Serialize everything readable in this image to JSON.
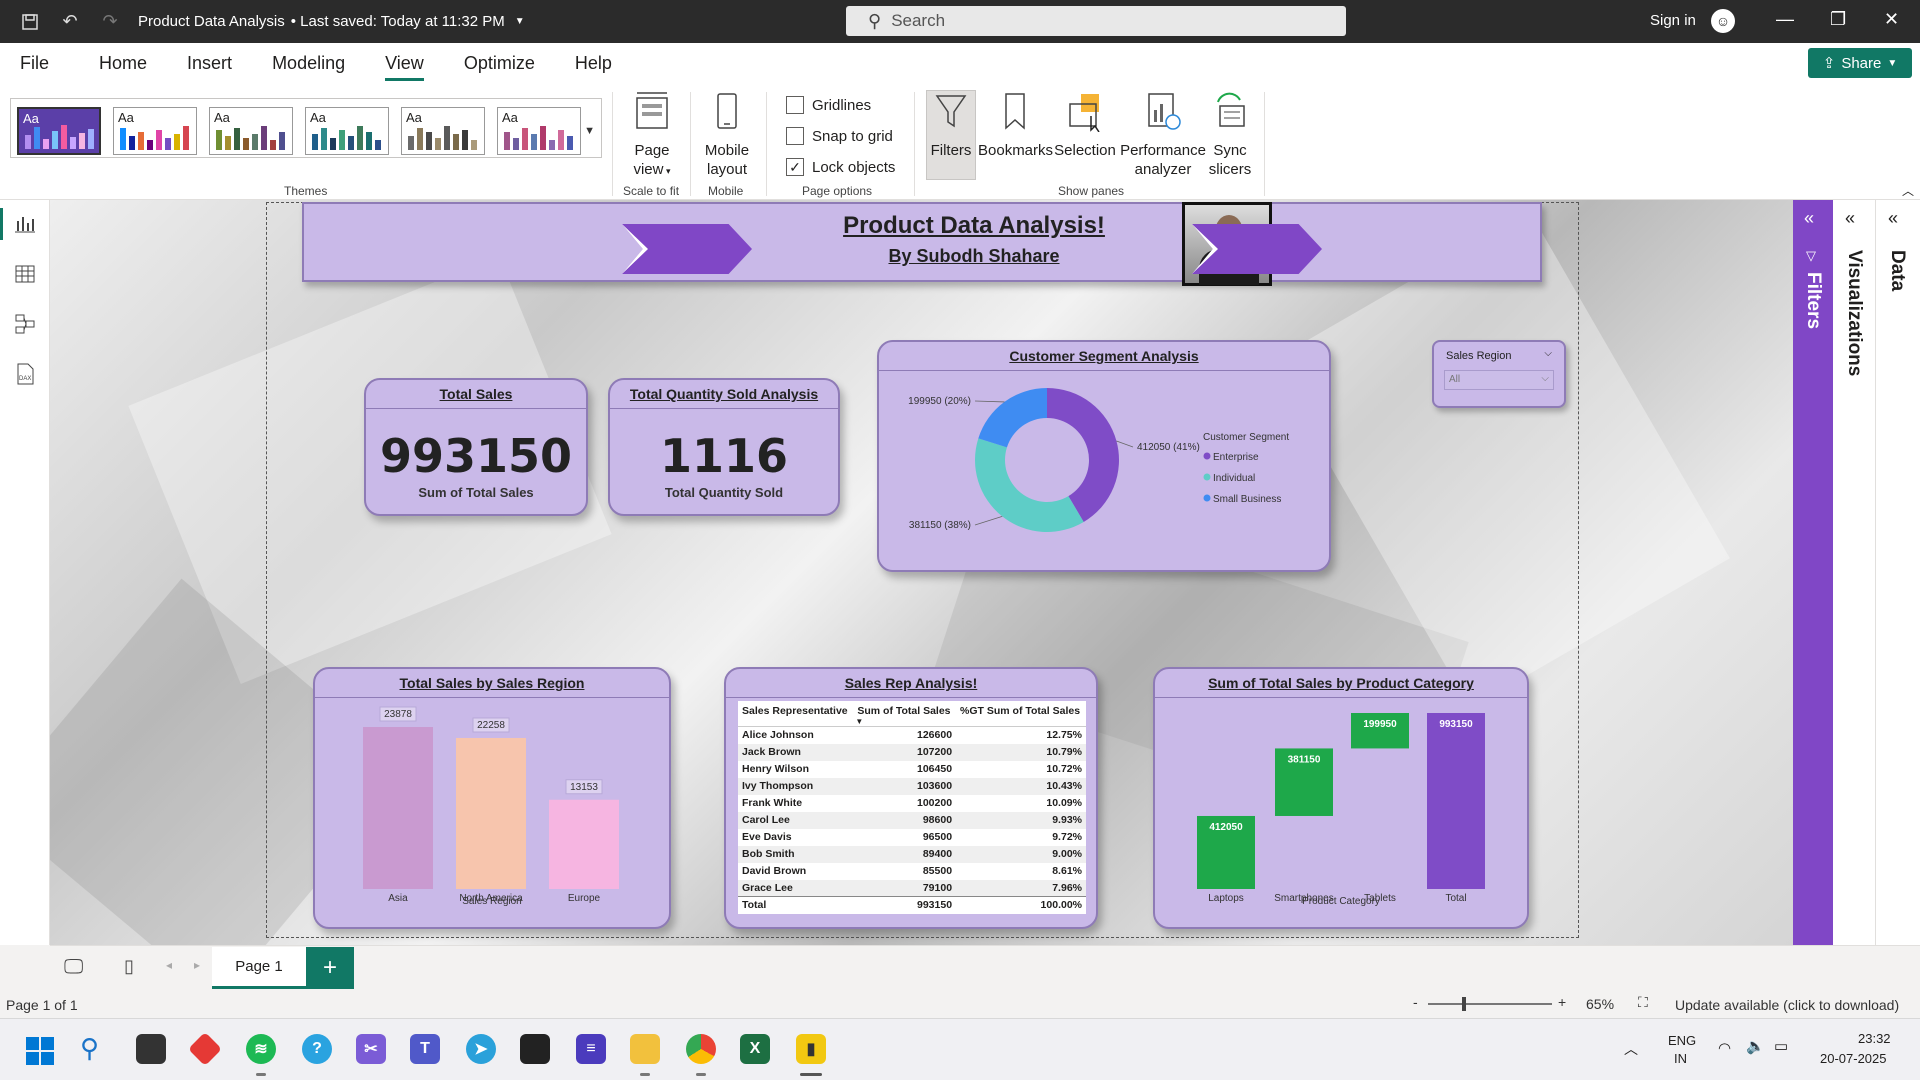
{
  "app": {
    "title": "Product Data Analysis",
    "saved": "• Last saved: Today at 11:32 PM",
    "search_placeholder": "Search",
    "sign_in": "Sign in",
    "share": "Share"
  },
  "menu": [
    "File",
    "Home",
    "Insert",
    "Modeling",
    "View",
    "Optimize",
    "Help"
  ],
  "menu_active": "View",
  "ribbon": {
    "themes_label": "Themes",
    "page_view": [
      "Page",
      "view"
    ],
    "scale_to_fit": "Scale to fit",
    "mobile_layout": [
      "Mobile",
      "layout"
    ],
    "mobile": "Mobile",
    "gridlines": "Gridlines",
    "snap_to_grid": "Snap to grid",
    "lock_objects": "Lock objects",
    "page_options": "Page options",
    "filters": "Filters",
    "bookmarks": "Bookmarks",
    "selection": "Selection",
    "performance": [
      "Performance",
      "analyzer"
    ],
    "sync": [
      "Sync",
      "slicers"
    ],
    "show_panes": "Show panes",
    "lock_checked": true,
    "theme_thumb_text": "Aa"
  },
  "report": {
    "banner_title": "Product Data Analysis!",
    "banner_sub": "By Subodh Shahare",
    "total_sales_title": "Total Sales",
    "total_sales_value": "993150",
    "total_sales_label": "Sum of Total Sales",
    "qty_title": "Total Quantity Sold Analysis",
    "qty_value": "1116",
    "qty_label": "Total Quantity Sold",
    "segment_title": "Customer Segment Analysis",
    "slicer_title": "Sales Region",
    "slicer_value": "All",
    "region_title": "Total Sales by Sales Region",
    "rep_title": "Sales Rep Analysis!",
    "category_title": "Sum of Total Sales by Product Category"
  },
  "chart_data": [
    {
      "type": "pie",
      "title": "Customer Segment Analysis",
      "legend_title": "Customer Segment",
      "legend_position": "right",
      "categories": [
        "Enterprise",
        "Individual",
        "Small Business"
      ],
      "values": [
        412050,
        381150,
        199950
      ],
      "data_labels": [
        "412050 (41%)",
        "381150 (38%)",
        "199950 (20%)"
      ],
      "colors": [
        "#7f4cc7",
        "#5ecdc7",
        "#3f8cf2"
      ]
    },
    {
      "type": "bar",
      "title": "Total Sales by Sales Region",
      "xlabel": "Sales Region",
      "categories": [
        "Asia",
        "North America",
        "Europe"
      ],
      "values": [
        23878,
        22258,
        13153
      ],
      "colors": [
        "#c99ad0",
        "#f7c5ad",
        "#f6b5e1"
      ]
    },
    {
      "type": "bar",
      "title": "Sum of Total Sales by Product Category",
      "xlabel": "Product Category",
      "categories": [
        "Laptops",
        "Smartphones",
        "Tablets",
        "Total"
      ],
      "values": [
        412050,
        381150,
        199950,
        993150
      ],
      "colors": [
        "#1ea84a",
        "#1ea84a",
        "#1ea84a",
        "#7f4cc7"
      ]
    },
    {
      "type": "table",
      "title": "Sales Rep Analysis!",
      "columns": [
        "Sales Representative",
        "Sum of Total Sales",
        "%GT Sum of Total Sales"
      ],
      "rows": [
        [
          "Alice Johnson",
          "126600",
          "12.75%"
        ],
        [
          "Jack Brown",
          "107200",
          "10.79%"
        ],
        [
          "Henry Wilson",
          "106450",
          "10.72%"
        ],
        [
          "Ivy Thompson",
          "103600",
          "10.43%"
        ],
        [
          "Frank White",
          "100200",
          "10.09%"
        ],
        [
          "Carol Lee",
          "98600",
          "9.93%"
        ],
        [
          "Eve Davis",
          "96500",
          "9.72%"
        ],
        [
          "Bob Smith",
          "89400",
          "9.00%"
        ],
        [
          "David Brown",
          "85500",
          "8.61%"
        ],
        [
          "Grace Lee",
          "79100",
          "7.96%"
        ]
      ],
      "total": [
        "Total",
        "993150",
        "100.00%"
      ]
    }
  ],
  "panes": {
    "filters": "Filters",
    "visualizations": "Visualizations",
    "data": "Data"
  },
  "pages": [
    "Page 1"
  ],
  "status": {
    "page_of": "Page 1 of 1",
    "zoom": "65%",
    "update": "Update available (click to download)"
  },
  "taskbar": {
    "lang": "ENG",
    "region": "IN",
    "time": "23:32",
    "date": "20-07-2025"
  }
}
